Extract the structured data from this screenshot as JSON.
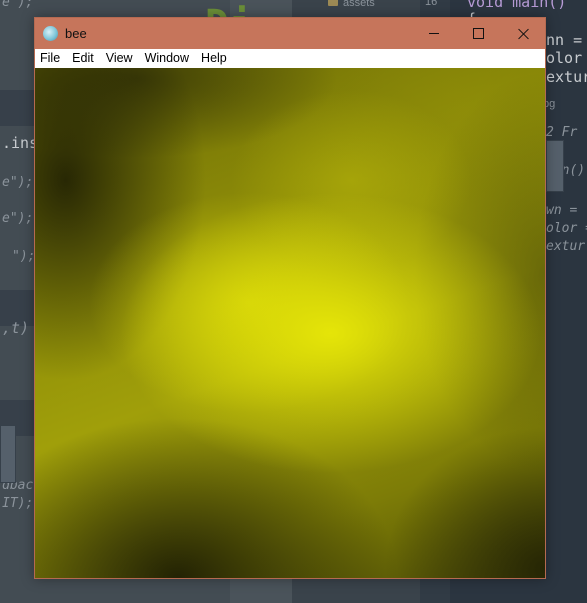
{
  "background": {
    "code_left": [
      ".ins",
      "e\");",
      "e\");",
      "\");",
      "e\");",
      ",t)",
      "dbac",
      "IT);"
    ],
    "code_heading": "Di",
    "tree_label": "assets",
    "tree_label_2": "pg",
    "line_number": "16",
    "code_right": [
      "void main()",
      "{",
      "nn = ",
      "olor =",
      "exture",
      "2 Fr",
      "ain()",
      "wn =",
      "olor =",
      "extur"
    ]
  },
  "window": {
    "title": "bee",
    "app_icon": "globe-icon",
    "controls": {
      "minimize": "minimize-icon",
      "maximize": "maximize-icon",
      "close": "close-icon"
    },
    "menu": [
      "File",
      "Edit",
      "View",
      "Window",
      "Help"
    ],
    "canvas": {
      "content": "yellow procedural cloud noise",
      "colors": {
        "bright": "#e8e808",
        "mid": "#8e8d08",
        "dark": "#2a2a04"
      }
    },
    "frame_color": "#c6755b"
  }
}
